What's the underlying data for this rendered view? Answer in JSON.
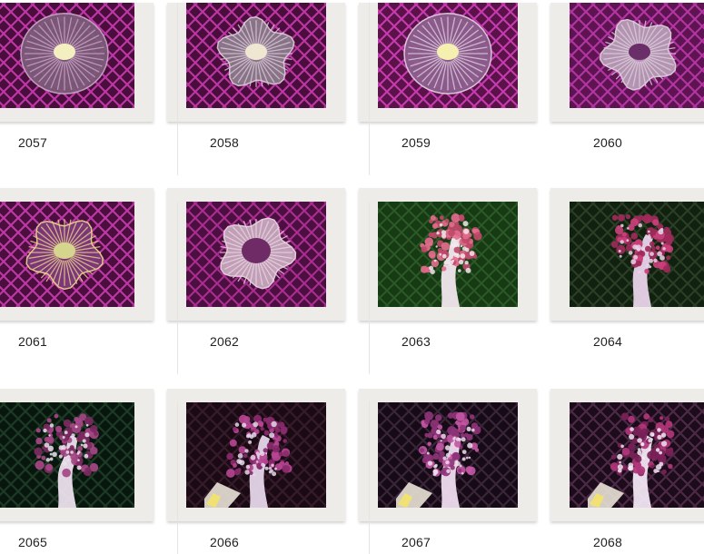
{
  "gallery": {
    "items": [
      {
        "id": "2057",
        "label": "2057",
        "kind": "mushroom",
        "bg": "#4a0e3c",
        "net": "#d13fb8",
        "disc": "#7d5a7a",
        "center": "#f3efc0",
        "stripe": "#c8a6c4"
      },
      {
        "id": "2058",
        "label": "2058",
        "kind": "mushroom-ruffled",
        "bg": "#4a0e3c",
        "net": "#cf3db4",
        "disc": "#8a7a8a",
        "center": "#f0e7d2",
        "stripe": "#dcc9d8"
      },
      {
        "id": "2059",
        "label": "2059",
        "kind": "mushroom",
        "bg": "#5a1248",
        "net": "#d743c0",
        "disc": "#8c5f8d",
        "center": "#f5f0b0",
        "stripe": "#e0cde0"
      },
      {
        "id": "2060",
        "label": "2060",
        "kind": "mushroom-ruffled",
        "bg": "#5c1550",
        "net": "#c43ab1",
        "disc": "#b79bb6",
        "center": "#6a2e68",
        "stripe": "#ded0dc"
      },
      {
        "id": "2061",
        "label": "2061",
        "kind": "mushroom-ruffled",
        "bg": "#4a0f3c",
        "net": "#d040b7",
        "disc": "#7e3a79",
        "center": "#d6d58e",
        "stripe": "#e6d28d"
      },
      {
        "id": "2062",
        "label": "2062",
        "kind": "mushroom-flower",
        "bg": "#4b0f40",
        "net": "#b8349d",
        "disc": "#c7a7bd",
        "center": "#6f2b66",
        "stripe": "#e8d6e0"
      },
      {
        "id": "2063",
        "label": "2063",
        "kind": "soft-coral",
        "bg": "#163a14",
        "net": "#2f5e2a",
        "disc": "#c04a6a",
        "center": "#f2e7ee",
        "stripe": "#e46b8d"
      },
      {
        "id": "2064",
        "label": "2064",
        "kind": "soft-coral",
        "bg": "#10220f",
        "net": "#30442a",
        "disc": "#9e2a5a",
        "center": "#e9d4ea",
        "stripe": "#c9407a"
      },
      {
        "id": "2065",
        "label": "2065",
        "kind": "soft-coral",
        "bg": "#08170d",
        "net": "#23402b",
        "disc": "#7c2a60",
        "center": "#ece0ee",
        "stripe": "#a64786"
      },
      {
        "id": "2066",
        "label": "2066",
        "kind": "soft-coral-tag",
        "bg": "#1a0a14",
        "net": "#3c1e30",
        "disc": "#8a2a6c",
        "center": "#e6d6ea",
        "stripe": "#b54591"
      },
      {
        "id": "2067",
        "label": "2067",
        "kind": "soft-coral-tag",
        "bg": "#160a16",
        "net": "#402a3e",
        "disc": "#8e3378",
        "center": "#efdcee",
        "stripe": "#c257a3"
      },
      {
        "id": "2068",
        "label": "2068",
        "kind": "soft-coral-tag",
        "bg": "#1c0b1a",
        "net": "#55304e",
        "disc": "#7a2258",
        "center": "#f2e6f3",
        "stripe": "#b1367a"
      }
    ]
  }
}
